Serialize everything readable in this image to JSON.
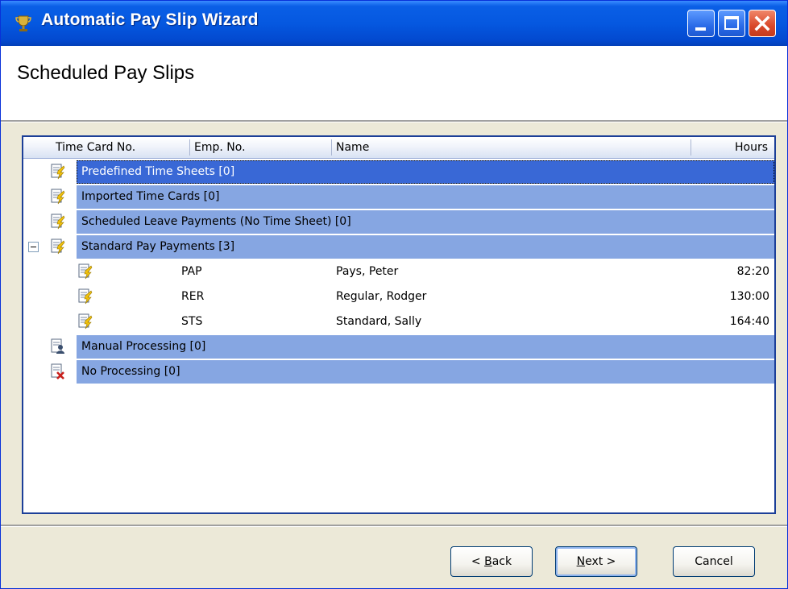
{
  "window": {
    "title": "Automatic Pay Slip Wizard"
  },
  "header": {
    "title": "Scheduled Pay Slips"
  },
  "columns": [
    "Time Card No.",
    "Emp. No.",
    "Name",
    "Hours"
  ],
  "groups": [
    {
      "label": "Predefined Time Sheets [0]",
      "icon": "timesheet-icon",
      "selected": true
    },
    {
      "label": "Imported Time Cards [0]",
      "icon": "timesheet-icon"
    },
    {
      "label": "Scheduled Leave Payments (No Time Sheet) [0]",
      "icon": "timesheet-icon"
    },
    {
      "label": "Standard Pay Payments [3]",
      "icon": "timesheet-icon",
      "expanded": true
    },
    {
      "label": "Manual Processing [0]",
      "icon": "manual-processing-icon"
    },
    {
      "label": "No Processing [0]",
      "icon": "no-processing-icon"
    }
  ],
  "standard_pay_rows": [
    {
      "emp_no": "PAP",
      "name": "Pays, Peter",
      "hours": "82:20"
    },
    {
      "emp_no": "RER",
      "name": "Regular, Rodger",
      "hours": "130:00"
    },
    {
      "emp_no": "STS",
      "name": "Standard, Sally",
      "hours": "164:40"
    }
  ],
  "buttons": {
    "back": {
      "pre": "< ",
      "key": "B",
      "post": "ack"
    },
    "next": {
      "key": "N",
      "post": "ext >"
    },
    "cancel": "Cancel"
  },
  "colors": {
    "title_bar": "#0558e0",
    "group_band": "#86a6e2",
    "selected_band": "#3968d6",
    "dialog_bg": "#ece9d8"
  }
}
